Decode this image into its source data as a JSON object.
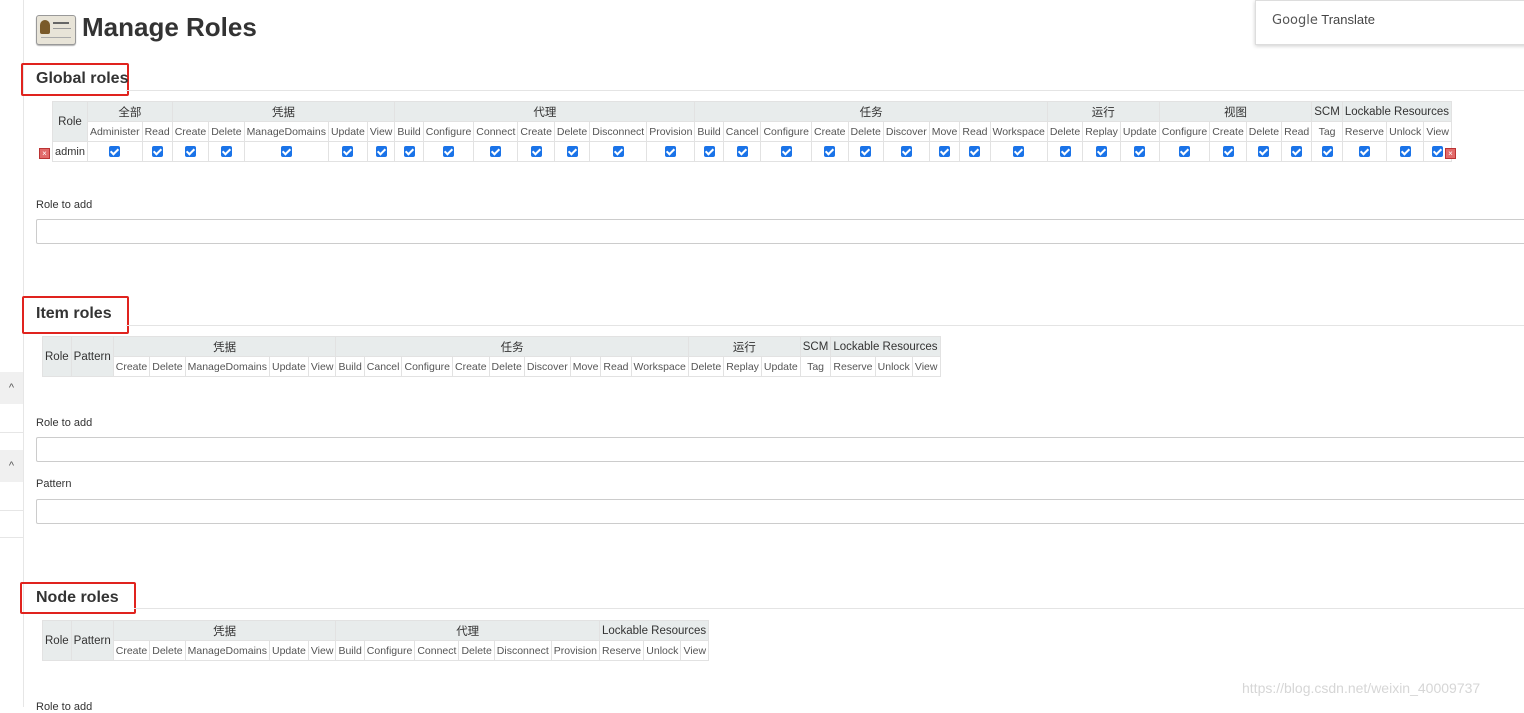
{
  "page": {
    "title": "Manage Roles"
  },
  "google_translate": {
    "label_google": "Google",
    "label_translate": "Translate"
  },
  "sidebar": {
    "chevron": "^"
  },
  "global_roles": {
    "title": "Global roles",
    "role_header": "Role",
    "groups": [
      {
        "label": "全部",
        "perms": [
          "Administer",
          "Read"
        ]
      },
      {
        "label": "凭据",
        "perms": [
          "Create",
          "Delete",
          "ManageDomains",
          "Update",
          "View"
        ]
      },
      {
        "label": "代理",
        "perms": [
          "Build",
          "Configure",
          "Connect",
          "Create",
          "Delete",
          "Disconnect",
          "Provision"
        ]
      },
      {
        "label": "任务",
        "perms": [
          "Build",
          "Cancel",
          "Configure",
          "Create",
          "Delete",
          "Discover",
          "Move",
          "Read",
          "Workspace"
        ]
      },
      {
        "label": "运行",
        "perms": [
          "Delete",
          "Replay",
          "Update"
        ]
      },
      {
        "label": "视图",
        "perms": [
          "Configure",
          "Create",
          "Delete",
          "Read"
        ]
      },
      {
        "label": "SCM",
        "perms": [
          "Tag"
        ]
      },
      {
        "label": "Lockable Resources",
        "perms": [
          "Reserve",
          "Unlock",
          "View"
        ]
      }
    ],
    "rows": [
      {
        "role": "admin",
        "all_checked": true
      }
    ],
    "role_to_add_label": "Role to add",
    "role_to_add_value": ""
  },
  "item_roles": {
    "title": "Item roles",
    "role_header": "Role",
    "pattern_header": "Pattern",
    "groups": [
      {
        "label": "凭据",
        "perms": [
          "Create",
          "Delete",
          "ManageDomains",
          "Update",
          "View"
        ]
      },
      {
        "label": "任务",
        "perms": [
          "Build",
          "Cancel",
          "Configure",
          "Create",
          "Delete",
          "Discover",
          "Move",
          "Read",
          "Workspace"
        ]
      },
      {
        "label": "运行",
        "perms": [
          "Delete",
          "Replay",
          "Update"
        ]
      },
      {
        "label": "SCM",
        "perms": [
          "Tag"
        ]
      },
      {
        "label": "Lockable Resources",
        "perms": [
          "Reserve",
          "Unlock",
          "View"
        ]
      }
    ],
    "role_to_add_label": "Role to add",
    "role_to_add_value": "",
    "pattern_label": "Pattern",
    "pattern_value": ""
  },
  "node_roles": {
    "title": "Node roles",
    "role_header": "Role",
    "pattern_header": "Pattern",
    "groups": [
      {
        "label": "凭据",
        "perms": [
          "Create",
          "Delete",
          "ManageDomains",
          "Update",
          "View"
        ]
      },
      {
        "label": "代理",
        "perms": [
          "Build",
          "Configure",
          "Connect",
          "Delete",
          "Disconnect",
          "Provision"
        ]
      },
      {
        "label": "Lockable Resources",
        "perms": [
          "Reserve",
          "Unlock",
          "View"
        ]
      }
    ],
    "role_to_add_label": "Role to add"
  },
  "watermark": "https://blog.csdn.net/weixin_40009737",
  "colors": {
    "highlight_box": "#e0231e",
    "checkbox": "#1a73e8",
    "header_bg": "#e8ecec"
  }
}
